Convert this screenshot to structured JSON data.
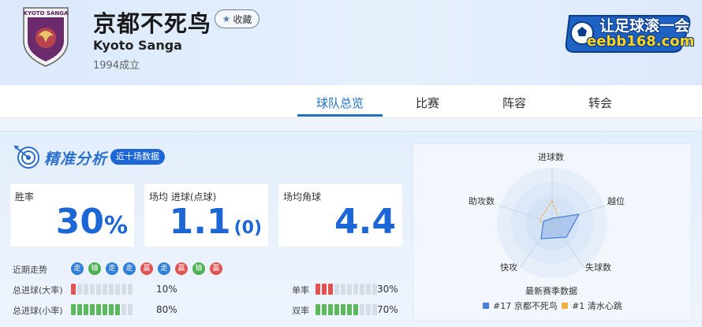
{
  "header": {
    "team_name_cn": "京都不死鸟",
    "fav_label": "收藏",
    "team_name_en": "Kyoto Sanga",
    "founded": "1994成立",
    "crest_text": "KYOTO SANGA",
    "brand_line1": "让足球滚一会",
    "brand_line2": "eebb168.com"
  },
  "tabs": [
    {
      "label": "球队总览",
      "active": true
    },
    {
      "label": "比赛",
      "active": false
    },
    {
      "label": "阵容",
      "active": false
    },
    {
      "label": "转会",
      "active": false
    }
  ],
  "analysis": {
    "title": "精准分析",
    "badge": "近十场数据",
    "stats": [
      {
        "label": "胜率",
        "value": "30",
        "unit": "%"
      },
      {
        "label": "场均 进球(点球)",
        "value": "1.1",
        "sub": "(0)"
      },
      {
        "label": "场均角球",
        "value": "4.4"
      }
    ],
    "recent_form_label": "近期走势",
    "recent_form": [
      "走",
      "输",
      "走",
      "走",
      "赢",
      "走",
      "赢",
      "输",
      "赢"
    ],
    "rates": [
      {
        "label": "总进球(大率)",
        "percent": 10,
        "text": "10%",
        "color": "red"
      },
      {
        "label": "单率",
        "percent": 30,
        "text": "30%",
        "color": "red"
      },
      {
        "label": "总进球(小率)",
        "percent": 80,
        "text": "80%",
        "color": "green"
      },
      {
        "label": "双率",
        "percent": 70,
        "text": "70%",
        "color": "green"
      }
    ]
  },
  "radar": {
    "axes": [
      "进球数",
      "越位",
      "失球数",
      "快攻",
      "助攻数"
    ],
    "caption": "最新赛季数据",
    "legend": [
      {
        "label": "#17 京都不死鸟",
        "color": "#4a7fd6"
      },
      {
        "label": "#1 清水心跳",
        "color": "#f0b040"
      }
    ]
  },
  "colors": {
    "accent": "#1d66d6",
    "win": "#e05353",
    "draw": "#2f7fd8",
    "loss": "#4caf50"
  }
}
